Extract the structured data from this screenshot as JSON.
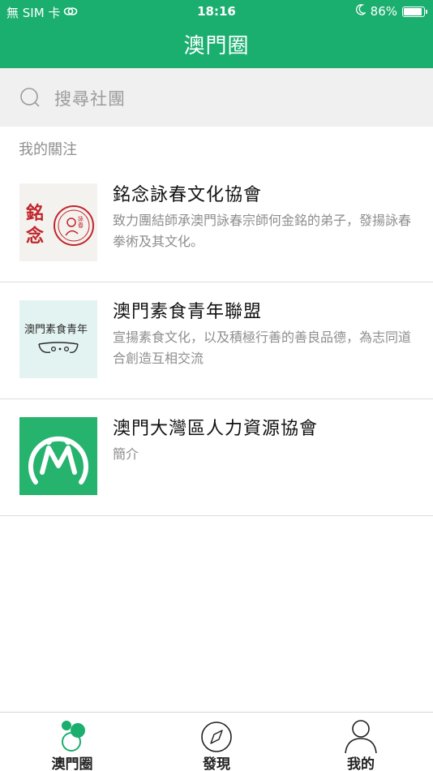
{
  "status_bar": {
    "carrier": "無 SIM 卡",
    "time": "18:16",
    "battery_percent": "86%",
    "battery_level": 0.86
  },
  "nav": {
    "title": "澳門圈"
  },
  "search": {
    "placeholder": "搜尋社團",
    "icon": "search-icon"
  },
  "section": {
    "label": "我的關注"
  },
  "clubs": [
    {
      "name": "銘念詠春文化協會",
      "description": "致力團結師承澳門詠春宗師何金銘的弟子，發揚詠春拳術及其文化。",
      "logo_text": "銘念",
      "logo_seal_text": "詠春"
    },
    {
      "name": "澳門素食青年聯盟",
      "description": "宣揚素食文化，以及積極行善的善良品德，為志同道合創造互相交流",
      "logo_text": "澳門素食青年"
    },
    {
      "name": "澳門大灣區人力資源協會",
      "description": "簡介",
      "logo_text": "M"
    }
  ],
  "tabs": [
    {
      "label": "澳門圈",
      "icon": "circles-icon",
      "active": true
    },
    {
      "label": "發現",
      "icon": "compass-icon",
      "active": false
    },
    {
      "label": "我的",
      "icon": "person-icon",
      "active": false
    }
  ],
  "colors": {
    "brand": "#1aae6f",
    "logo_red": "#c0252b",
    "logo_mint": "#e3f3f1",
    "logo_green": "#26b36d"
  }
}
